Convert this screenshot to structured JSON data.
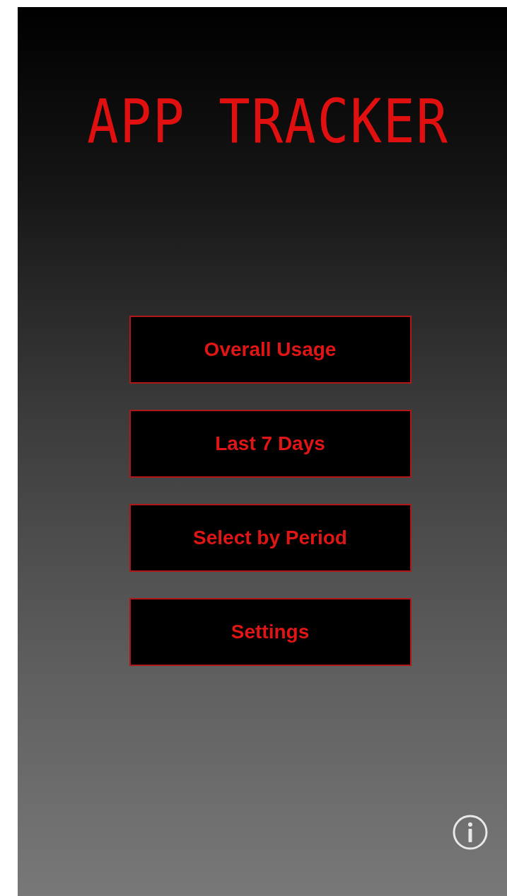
{
  "title": "APP TRACKER",
  "buttons": [
    {
      "label": "Overall Usage"
    },
    {
      "label": "Last 7 Days"
    },
    {
      "label": "Select by Period"
    },
    {
      "label": "Settings"
    }
  ]
}
